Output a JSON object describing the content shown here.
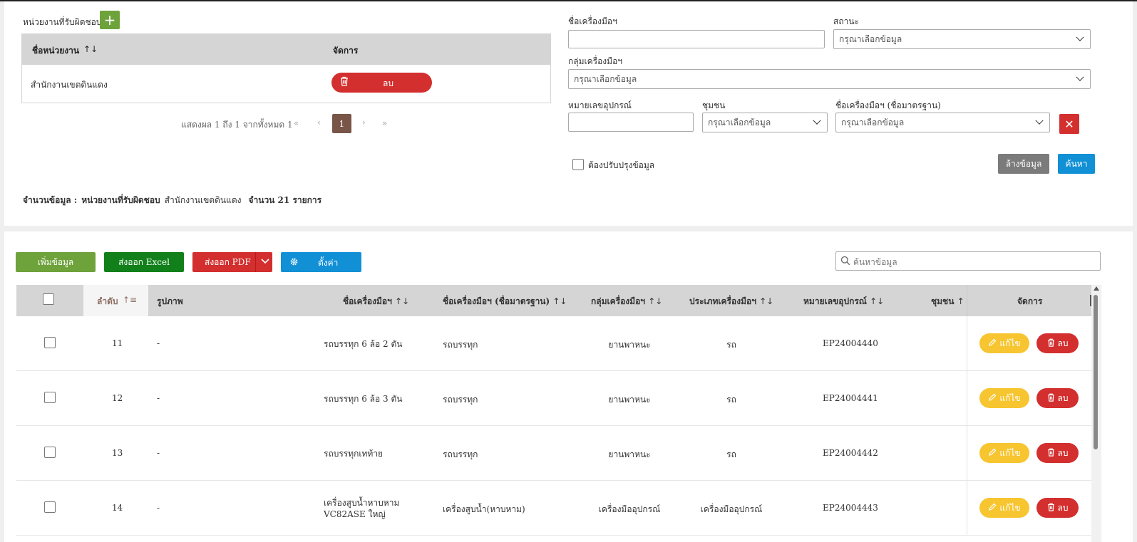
{
  "unit_section": {
    "title": "หน่วยงานที่รับผิดชอบ",
    "add_icon": "plus-icon",
    "columns": [
      "ชื่อหน่วยงาน",
      "จัดการ"
    ],
    "sort_glyph": "↑↓",
    "rows": [
      {
        "name": "สำนักงานเขตดินแดง",
        "delete_label": "ลบ"
      }
    ],
    "pager": {
      "info": "แสดงผล 1 ถึง 1 จากทั้งหมด 1",
      "first": "«",
      "prev": "‹",
      "current": "1",
      "next": "›",
      "last": "»"
    }
  },
  "filters": {
    "tool_name_label": "ชื่อเครื่องมือฯ",
    "status_label": "สถานะ",
    "status_placeholder": "กรุณาเลือกข้อมูล",
    "group_label": "กลุ่มเครื่องมือฯ",
    "group_placeholder": "กรุณาเลือกข้อมูล",
    "equipment_no_label": "หมายเลขอุปกรณ์",
    "community_label": "ชุมชน",
    "community_placeholder": "กรุณาเลือกข้อมูล",
    "std_name_label": "ชื่อเครื่องมือฯ (ชื่อมาตรฐาน)",
    "std_name_placeholder": "กรุณาเลือกข้อมูล",
    "clear_x": "✕",
    "needs_update_label": "ต้องปรับปรุงข้อมูล",
    "clear_button": "ล้างข้อมูล",
    "search_button": "ค้นหา"
  },
  "summary": {
    "label": "จำนวนข้อมูล :",
    "unit_label": "หน่วยงานที่รับผิดชอบ",
    "unit_value": "สำนักงานเขตดินแดง",
    "count_text": "จำนวน 21 รายการ"
  },
  "toolbar": {
    "add": "เพิ่มข้อมูล",
    "export_excel": "ส่งออก Excel",
    "export_pdf": "ส่งออก PDF",
    "settings": "ตั้งค่า",
    "search_placeholder": "ค้นหาข้อมูล"
  },
  "colors": {
    "green": "#6ea23b",
    "dark_green": "#11801a",
    "red": "#d32f2f",
    "blue": "#1190d6",
    "gray": "#7b7b7b",
    "yellow": "#f7c530",
    "brown_page": "#795548"
  },
  "table": {
    "columns": {
      "index": "ลำดับ",
      "image": "รูปภาพ",
      "name": "ชื่อเครื่องมือฯ",
      "std_name": "ชื่อเครื่องมือฯ (ชื่อมาตรฐาน)",
      "group": "กลุ่มเครื่องมือฯ",
      "type": "ประเภทเครื่องมือฯ",
      "equipment_no": "หมายเลขอุปกรณ์",
      "community": "ชุมชน",
      "manage": "จัดการ"
    },
    "sort_both": "↑↓",
    "sort_asc": "↑",
    "sort_asc_active": "↑≡",
    "edit_label": "แก้ไข",
    "delete_label": "ลบ",
    "rows": [
      {
        "index": "11",
        "image": "-",
        "name_1": "รถบรรทุก 6 ล้อ 2 ตัน",
        "name_2": "",
        "std_name": "รถบรรทุก",
        "group": "ยานพาหนะ",
        "type": "รถ",
        "equipment_no": "EP24004440",
        "community": ""
      },
      {
        "index": "12",
        "image": "-",
        "name_1": "รถบรรทุก 6 ล้อ 3 ตัน",
        "name_2": "",
        "std_name": "รถบรรทุก",
        "group": "ยานพาหนะ",
        "type": "รถ",
        "equipment_no": "EP24004441",
        "community": ""
      },
      {
        "index": "13",
        "image": "-",
        "name_1": "รถบรรทุกเทท้าย",
        "name_2": "",
        "std_name": "รถบรรทุก",
        "group": "ยานพาหนะ",
        "type": "รถ",
        "equipment_no": "EP24004442",
        "community": ""
      },
      {
        "index": "14",
        "image": "-",
        "name_1": "เครื่องสูบน้ำหาบหาม",
        "name_2": "VC82ASE ใหญ่",
        "std_name": "เครื่องสูบน้ำ(หาบหาม)",
        "group": "เครื่องมืออุปกรณ์",
        "type": "เครื่องมืออุปกรณ์",
        "equipment_no": "EP24004443",
        "community": ""
      }
    ]
  }
}
